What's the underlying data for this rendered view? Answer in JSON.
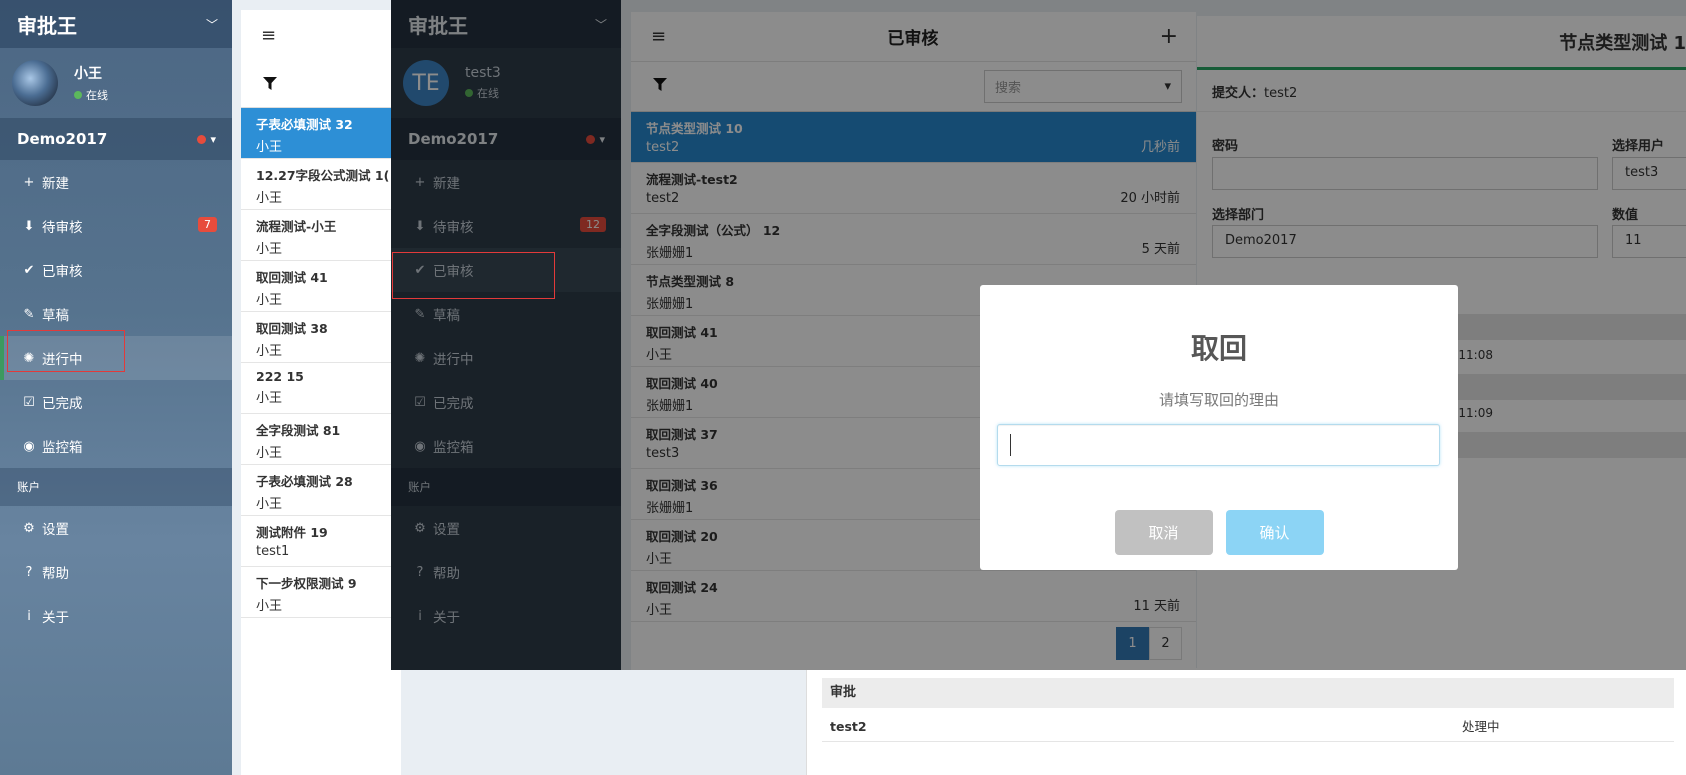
{
  "app1": {
    "brand": "审批王",
    "user": {
      "name": "小王",
      "status": "在线"
    },
    "org": "Demo2017",
    "menu": [
      {
        "icon": "plus-icon",
        "glyph": "+",
        "label": "新建",
        "badge": ""
      },
      {
        "icon": "inbox-icon",
        "glyph": "⬇",
        "label": "待审核",
        "badge": "7"
      },
      {
        "icon": "double-check-icon",
        "glyph": "✔",
        "label": "已审核",
        "badge": ""
      },
      {
        "icon": "edit-icon",
        "glyph": "✎",
        "label": "草稿",
        "badge": ""
      },
      {
        "icon": "spinner-icon",
        "glyph": "✺",
        "label": "进行中",
        "badge": ""
      },
      {
        "icon": "checkbox-icon",
        "glyph": "☑",
        "label": "已完成",
        "badge": ""
      },
      {
        "icon": "eye-icon",
        "glyph": "◉",
        "label": "监控箱",
        "badge": ""
      }
    ],
    "section_account": "账户",
    "account_menu": [
      {
        "icon": "gear-icon",
        "glyph": "⚙",
        "label": "设置"
      },
      {
        "icon": "help-icon",
        "glyph": "?",
        "label": "帮助"
      },
      {
        "icon": "info-icon",
        "glyph": "i",
        "label": "关于"
      }
    ],
    "list": [
      {
        "title": "子表必填测试 32",
        "sub": "小王"
      },
      {
        "title": "12.27字段公式测试 1(",
        "sub": "小王"
      },
      {
        "title": "流程测试-小王",
        "sub": "小王"
      },
      {
        "title": "取回测试 41",
        "sub": "小王"
      },
      {
        "title": "取回测试 38",
        "sub": "小王"
      },
      {
        "title": "222 15",
        "sub": "小王"
      },
      {
        "title": "全字段测试 81",
        "sub": "小王"
      },
      {
        "title": "子表必填测试 28",
        "sub": "小王"
      },
      {
        "title": "测试附件 19",
        "sub": "test1"
      },
      {
        "title": "下一步权限测试 9",
        "sub": "小王"
      }
    ],
    "approval": {
      "header": "审批",
      "who": "test2",
      "status": "处理中"
    }
  },
  "app2": {
    "brand": "审批王",
    "user": {
      "initials": "TE",
      "name": "test3",
      "status": "在线"
    },
    "org": "Demo2017",
    "menu": [
      {
        "icon": "plus-icon",
        "glyph": "+",
        "label": "新建",
        "badge": ""
      },
      {
        "icon": "inbox-icon",
        "glyph": "⬇",
        "label": "待审核",
        "badge": "12"
      },
      {
        "icon": "double-check-icon",
        "glyph": "✔",
        "label": "已审核",
        "badge": ""
      },
      {
        "icon": "edit-icon",
        "glyph": "✎",
        "label": "草稿",
        "badge": ""
      },
      {
        "icon": "spinner-icon",
        "glyph": "✺",
        "label": "进行中",
        "badge": ""
      },
      {
        "icon": "checkbox-icon",
        "glyph": "☑",
        "label": "已完成",
        "badge": ""
      },
      {
        "icon": "eye-icon",
        "glyph": "◉",
        "label": "监控箱",
        "badge": ""
      }
    ],
    "section_account": "账户",
    "account_menu": [
      {
        "icon": "gear-icon",
        "glyph": "⚙",
        "label": "设置"
      },
      {
        "icon": "help-icon",
        "glyph": "?",
        "label": "帮助"
      },
      {
        "icon": "info-icon",
        "glyph": "i",
        "label": "关于"
      }
    ],
    "review": {
      "title": "已审核",
      "search_placeholder": "搜索",
      "items": [
        {
          "title": "节点类型测试 10",
          "sub": "test2",
          "time": "几秒前"
        },
        {
          "title": "流程测试-test2",
          "sub": "test2",
          "time": "20 小时前"
        },
        {
          "title": "全字段测试（公式） 12",
          "sub": "张姗姗1",
          "time": "5 天前"
        },
        {
          "title": "节点类型测试 8",
          "sub": "张姗姗1",
          "time": ""
        },
        {
          "title": "取回测试 41",
          "sub": "小王",
          "time": ""
        },
        {
          "title": "取回测试 40",
          "sub": "张姗姗1",
          "time": ""
        },
        {
          "title": "取回测试 37",
          "sub": "test3",
          "time": ""
        },
        {
          "title": "取回测试 36",
          "sub": "张姗姗1",
          "time": ""
        },
        {
          "title": "取回测试 20",
          "sub": "小王",
          "time": ""
        },
        {
          "title": "取回测试 24",
          "sub": "小王",
          "time": "11 天前"
        }
      ],
      "pages": [
        "1",
        "2"
      ]
    },
    "detail": {
      "title": "节点类型测试 1",
      "submitter_label": "提交人：",
      "submitter": "test2",
      "password_label": "密码",
      "password_value": "",
      "user_label": "选择用户",
      "user_value": "test3",
      "dept_label": "选择部门",
      "dept_value": "Demo2017",
      "number_label": "数值",
      "number_value": "11",
      "time1": "-17 11:08",
      "time2": "-17 11:09"
    }
  },
  "modal": {
    "title": "取回",
    "text": "请填写取回的理由",
    "input_value": "",
    "cancel": "取消",
    "confirm": "确认"
  }
}
